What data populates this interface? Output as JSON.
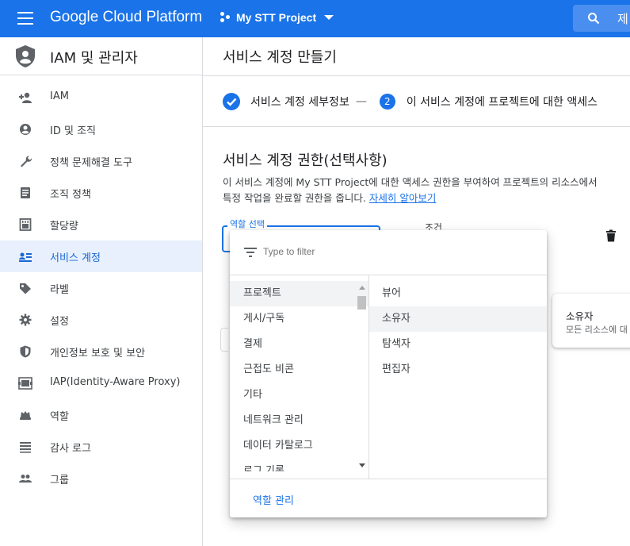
{
  "header": {
    "brand": "Google Cloud Platform",
    "project": "My STT Project",
    "search_placeholder": "제"
  },
  "sidebar": {
    "title": "IAM 및 관리자",
    "items": [
      {
        "label": "IAM",
        "icon": "person-add-icon"
      },
      {
        "label": "ID 및 조직",
        "icon": "account-circle-icon"
      },
      {
        "label": "정책 문제해결 도구",
        "icon": "wrench-icon"
      },
      {
        "label": "조직 정책",
        "icon": "article-icon"
      },
      {
        "label": "할당량",
        "icon": "quota-icon"
      },
      {
        "label": "서비스 계정",
        "icon": "service-account-icon",
        "active": true
      },
      {
        "label": "라벨",
        "icon": "label-tag-icon"
      },
      {
        "label": "설정",
        "icon": "gear-icon"
      },
      {
        "label": "개인정보 보호 및 보안",
        "icon": "security-shield-icon"
      },
      {
        "label": "IAP(Identity-Aware Proxy)",
        "icon": "iap-icon"
      },
      {
        "label": "역할",
        "icon": "hat-icon"
      },
      {
        "label": "감사 로그",
        "icon": "list-icon"
      },
      {
        "label": "그룹",
        "icon": "group-icon"
      }
    ]
  },
  "main": {
    "title": "서비스 계정 만들기",
    "stepper": {
      "step1_label": "서비스 계정 세부정보",
      "separator": "—",
      "step2_number": "2",
      "step2_label": "이 서비스 계정에 프로젝트에 대한 액세스"
    },
    "section": {
      "title": "서비스 계정 권한(선택사항)",
      "desc_line1": "이 서비스 계정에 My STT Project에 대한 액세스 권한을 부여하여 프로젝트의 리소스에서",
      "desc_line2": "특정 작업을 완료할 권한을 줍니다.",
      "learn_more": "자세히 알아보기"
    },
    "role_field_label": "역할 선택",
    "condition_label": "조건",
    "peek_card": {
      "title": "소유자",
      "desc": "모든 리소스에 대"
    }
  },
  "dropdown": {
    "filter_placeholder": "Type to filter",
    "categories": [
      "프로젝트",
      "게시/구독",
      "결제",
      "근접도 비콘",
      "기타",
      "네트워크 관리",
      "데이터 카탈로그",
      "로그 기록"
    ],
    "selected_category": "프로젝트",
    "roles": [
      "뷰어",
      "소유자",
      "탐색자",
      "편집자"
    ],
    "highlighted_role": "소유자",
    "manage_roles": "역할 관리"
  },
  "colors": {
    "brand_blue": "#1a73e8",
    "active_bg": "#e8f0fe",
    "divider": "#dadce0"
  }
}
